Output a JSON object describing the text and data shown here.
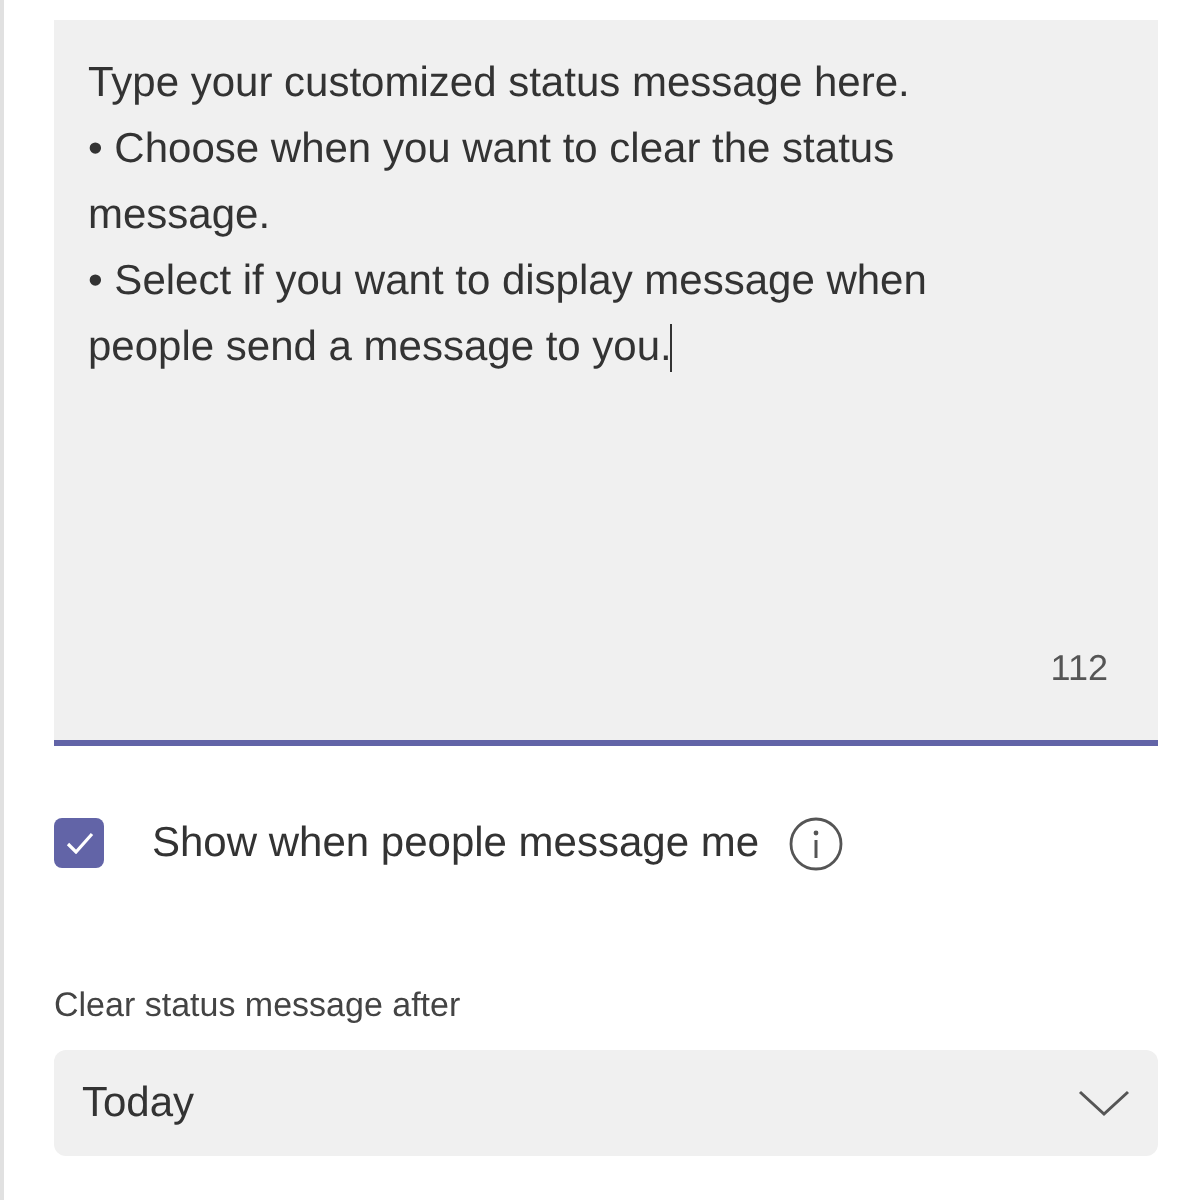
{
  "status_message": {
    "value": "Type your customized status message here.\n• Choose when you want to clear the status message.\n• Select if you want to display message when people send a message to you.",
    "focused": true,
    "counter": "112"
  },
  "show_when_messaged": {
    "label": "Show when people message me",
    "checked": true
  },
  "clear_after": {
    "label": "Clear status message after",
    "value": "Today"
  }
}
